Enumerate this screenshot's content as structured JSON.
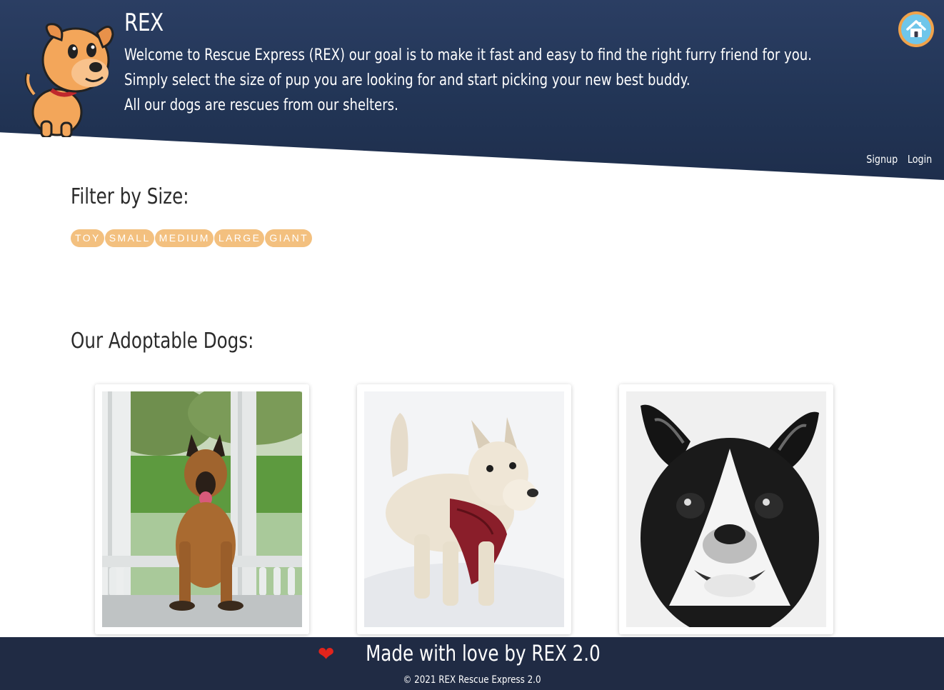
{
  "header": {
    "brand": "REX",
    "intro_lines": [
      "Welcome to Rescue Express (REX) our goal is to make it fast and easy to find the right furry friend for you.",
      "Simply select the size of pup you are looking for and start picking your new best buddy.",
      "All our dogs are rescues from our shelters."
    ],
    "mascot_icon": "cartoon-dog-icon",
    "home_icon": "house-icon",
    "nav": {
      "signup": "Signup",
      "login": "Login"
    }
  },
  "filter": {
    "title": "Filter by Size:",
    "options": [
      "TOY",
      "SMALL",
      "MEDIUM",
      "LARGE",
      "GIANT"
    ]
  },
  "dogs": {
    "title": "Our Adoptable Dogs:",
    "items": [
      {
        "photo": "belgian-malinois-photo"
      },
      {
        "photo": "wheaten-scottish-terrier-photo"
      },
      {
        "photo": "boston-terrier-photo"
      }
    ]
  },
  "footer": {
    "heart_icon": "heart-icon",
    "tagline": "Made with love by REX 2.0",
    "copyright": "© 2021 REX Rescue Express 2.0"
  },
  "colors": {
    "header_bg": "#223556",
    "chip_bg": "#f3c07f",
    "footer_bg": "#202b44",
    "home_ring": "#f0a24a",
    "home_fill": "#6fc6ea"
  }
}
